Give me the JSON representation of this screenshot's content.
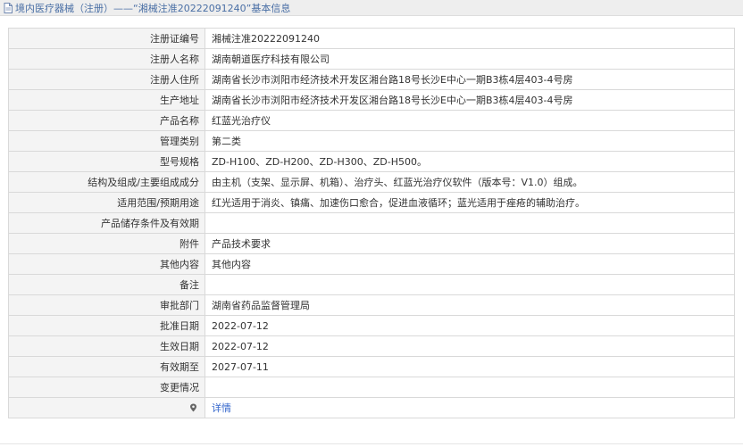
{
  "header": {
    "title": "境内医疗器械（注册）——“湘械注准20222091240”基本信息"
  },
  "rows": [
    {
      "label": "注册证编号",
      "value": "湘械注准20222091240"
    },
    {
      "label": "注册人名称",
      "value": "湖南朝道医疗科技有限公司"
    },
    {
      "label": "注册人住所",
      "value": "湖南省长沙市浏阳市经济技术开发区湘台路18号长沙E中心一期B3栋4层403-4号房"
    },
    {
      "label": "生产地址",
      "value": "湖南省长沙市浏阳市经济技术开发区湘台路18号长沙E中心一期B3栋4层403-4号房"
    },
    {
      "label": "产品名称",
      "value": "红蓝光治疗仪"
    },
    {
      "label": "管理类别",
      "value": "第二类"
    },
    {
      "label": "型号规格",
      "value": "ZD-H100、ZD-H200、ZD-H300、ZD-H500。"
    },
    {
      "label": "结构及组成/主要组成成分",
      "value": "由主机（支架、显示屏、机箱）、治疗头、红蓝光治疗仪软件（版本号：V1.0）组成。"
    },
    {
      "label": "适用范围/预期用途",
      "value": "红光适用于消炎、镇痛、加速伤口愈合，促进血液循环；蓝光适用于痤疮的辅助治疗。"
    },
    {
      "label": "产品储存条件及有效期",
      "value": ""
    },
    {
      "label": "附件",
      "value": "产品技术要求"
    },
    {
      "label": "其他内容",
      "value": "其他内容"
    },
    {
      "label": "备注",
      "value": ""
    },
    {
      "label": "审批部门",
      "value": "湖南省药品监督管理局"
    },
    {
      "label": "批准日期",
      "value": "2022-07-12"
    },
    {
      "label": "生效日期",
      "value": "2022-07-12"
    },
    {
      "label": "有效期至",
      "value": "2027-07-11"
    },
    {
      "label": "变更情况",
      "value": ""
    }
  ],
  "last_row": {
    "label": "",
    "link": "详情",
    "label_icon": "map-pin-icon"
  },
  "colors": {
    "header_bg": "#eeeeee",
    "header_text": "#4a6fa5",
    "label_bg": "#f4f4f4",
    "border": "#d9d9d9",
    "link": "#3366cc"
  }
}
